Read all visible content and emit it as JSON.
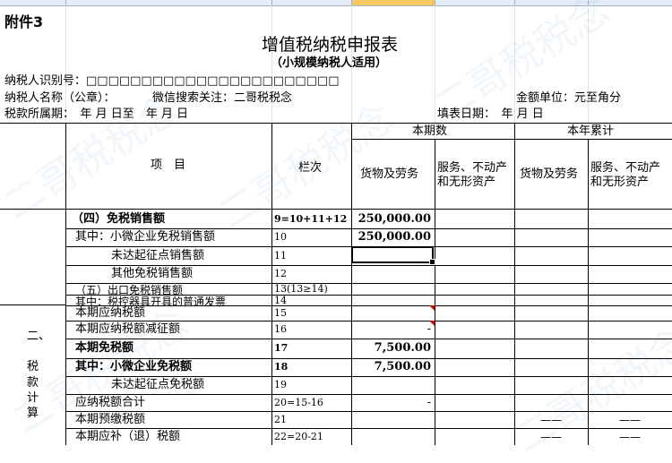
{
  "sheet": {
    "attachment": "附件3",
    "title": "增值税纳税申报表",
    "subtitle": "（小规模纳税人适用）",
    "taxpayer_id_label": "纳税人识别号：□□□□□□□□□□□□□□□□□□□□□□□",
    "taxpayer_name_label": "纳税人名称（公章）：",
    "wechat_note": "微信搜索关注：二哥税税念",
    "currency_unit": "金额单位：元至角分",
    "period_label": "税款所属期：　年 月 日至　年 月 日",
    "fill_date_label": "填表日期：　年 月 日",
    "watermark": "二哥税税念"
  },
  "headers": {
    "item": "项　目",
    "column": "栏次",
    "current_period": "本期数",
    "year_cumulative": "本年累计",
    "goods_services": "货物及劳务",
    "services_property_line1": "服务、不动产",
    "services_property_line2": "和无形资产"
  },
  "section_label": [
    "二、",
    "税",
    "款",
    "计",
    "算"
  ],
  "rows": [
    {
      "item": "（四）免税销售额",
      "col": "9=10+11+12",
      "goods": "250,000.00",
      "bold": true
    },
    {
      "item": "其中：小微企业免税销售额",
      "col": "10",
      "goods": "250,000.00",
      "bold": false
    },
    {
      "item": "未达起征点销售额",
      "col": "11",
      "goods": "",
      "bold": false
    },
    {
      "item": "其他免税销售额",
      "col": "12",
      "goods": "",
      "bold": false
    },
    {
      "item": "（五）出口免税销售额",
      "col": "13(13≥14)",
      "goods": "",
      "bold": false
    },
    {
      "item": "其中：税控器具开具的普通发票",
      "col": "14",
      "goods": "",
      "bold": false
    },
    {
      "item": "本期应纳税额",
      "col": "15",
      "goods": "",
      "bold": false
    },
    {
      "item": "本期应纳税额减征额",
      "col": "16",
      "goods": "-",
      "bold": false
    },
    {
      "item": "本期免税额",
      "col": "17",
      "goods": "7,500.00",
      "bold": true
    },
    {
      "item": "其中：小微企业免税额",
      "col": "18",
      "goods": "7,500.00",
      "bold": true
    },
    {
      "item": "未达起征点免税额",
      "col": "19",
      "goods": "",
      "bold": false
    },
    {
      "item": "应纳税额合计",
      "col": "20=15-16",
      "goods": "-",
      "bold": false
    },
    {
      "item": "本期预缴税额",
      "col": "21",
      "goods": "",
      "bold": false,
      "dash": "——"
    },
    {
      "item": "本期应补（退）税额",
      "col": "22=20-21",
      "goods": "",
      "bold": false,
      "dash": "——"
    }
  ]
}
